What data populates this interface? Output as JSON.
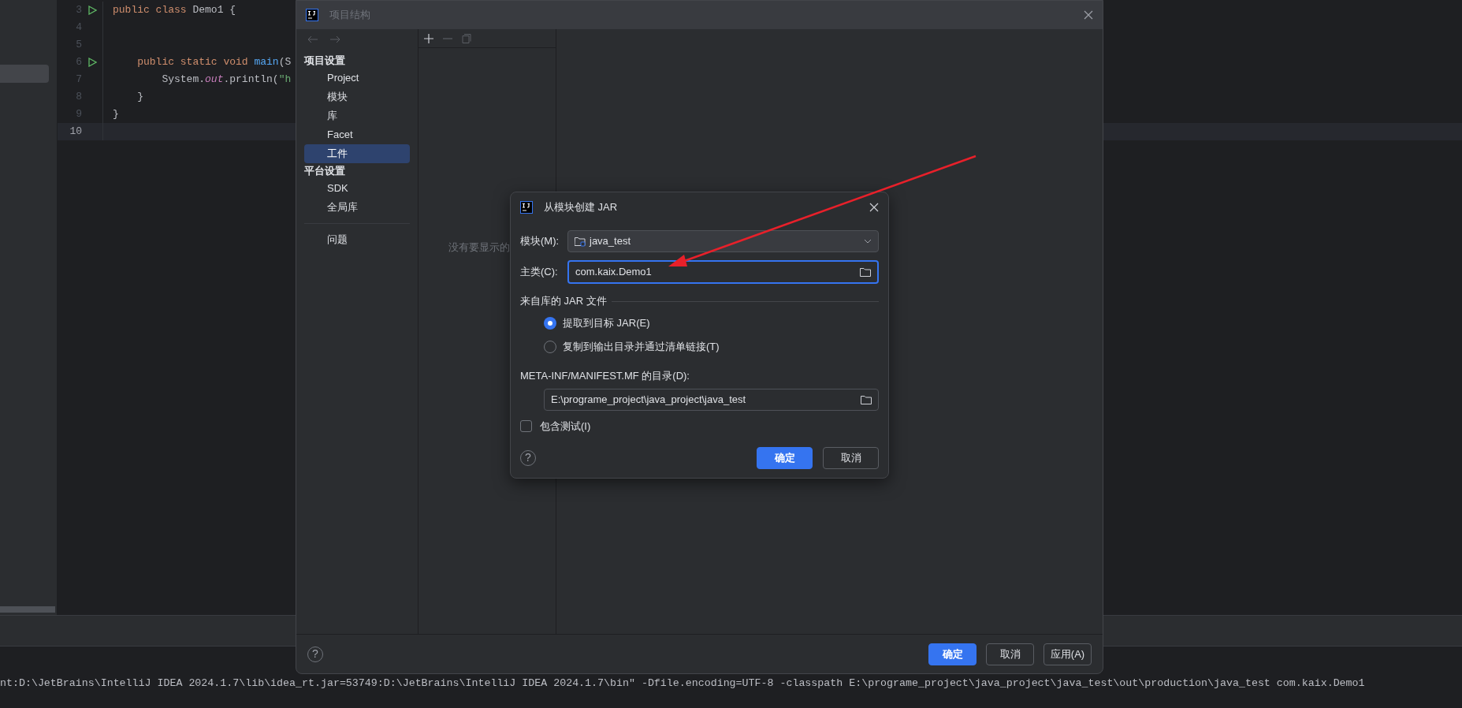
{
  "editor": {
    "lines": [
      {
        "number": "3",
        "run": true,
        "current": false,
        "tokens": [
          {
            "kind": "keyword",
            "text": "public class "
          },
          {
            "kind": "plain",
            "text": "Demo1 {"
          }
        ]
      },
      {
        "number": "4",
        "run": false,
        "current": false
      },
      {
        "number": "5",
        "run": false,
        "current": false
      },
      {
        "number": "6",
        "run": true,
        "current": false,
        "tokens": [
          {
            "kind": "keyword",
            "text": "    public static void "
          },
          {
            "kind": "method",
            "text": "main"
          },
          {
            "kind": "plain",
            "text": "(S"
          }
        ]
      },
      {
        "number": "7",
        "run": false,
        "current": false,
        "tokens": [
          {
            "kind": "plain",
            "text": "        System."
          },
          {
            "kind": "field",
            "text": "out"
          },
          {
            "kind": "plain",
            "text": ".println("
          },
          {
            "kind": "string",
            "text": "\"h"
          }
        ]
      },
      {
        "number": "8",
        "run": false,
        "current": false,
        "tokens": [
          {
            "kind": "plain",
            "text": "    }"
          }
        ]
      },
      {
        "number": "9",
        "run": false,
        "current": false,
        "tokens": [
          {
            "kind": "plain",
            "text": "}"
          }
        ]
      },
      {
        "number": "10",
        "run": false,
        "current": true
      }
    ]
  },
  "console": {
    "text": "nt:D:\\JetBrains\\IntelliJ IDEA 2024.1.7\\lib\\idea_rt.jar=53749:D:\\JetBrains\\IntelliJ IDEA 2024.1.7\\bin\" -Dfile.encoding=UTF-8 -classpath E:\\programe_project\\java_project\\java_test\\out\\production\\java_test com.kaix.Demo1"
  },
  "project_structure": {
    "title": "项目结构",
    "nav": [
      {
        "kind": "header",
        "label": "项目设置"
      },
      {
        "kind": "item",
        "label": "Project",
        "selected": false
      },
      {
        "kind": "item",
        "label": "模块",
        "selected": false
      },
      {
        "kind": "item",
        "label": "库",
        "selected": false
      },
      {
        "kind": "item",
        "label": "Facet",
        "selected": false
      },
      {
        "kind": "item",
        "label": "工件",
        "selected": true
      },
      {
        "kind": "header",
        "label": "平台设置"
      },
      {
        "kind": "item",
        "label": "SDK",
        "selected": false
      },
      {
        "kind": "item",
        "label": "全局库",
        "selected": false
      },
      {
        "kind": "divider"
      },
      {
        "kind": "item",
        "label": "问题",
        "selected": false
      }
    ],
    "empty_text": "没有要显示的",
    "help": "?",
    "buttons": [
      {
        "label": "确定",
        "primary": true
      },
      {
        "label": "取消",
        "primary": false
      },
      {
        "label": "应用(A)",
        "primary": false
      }
    ]
  },
  "create_jar": {
    "title": "从模块创建 JAR",
    "module": {
      "label": "模块(M):",
      "value": "java_test"
    },
    "main_class": {
      "label": "主类(C):",
      "value": "com.kaix.Demo1"
    },
    "section": "来自库的 JAR 文件",
    "options": [
      {
        "label": "提取到目标 JAR(E)",
        "selected": true
      },
      {
        "label": "复制到输出目录并通过清单链接(T)",
        "selected": false
      }
    ],
    "manifest": {
      "label": "META-INF/MANIFEST.MF 的目录(D):",
      "value": "E:\\programe_project\\java_project\\java_test"
    },
    "include_tests": {
      "label": "包含测试(I)",
      "checked": false
    },
    "help": "?",
    "buttons": [
      {
        "label": "确定",
        "primary": true
      },
      {
        "label": "取消",
        "primary": false
      }
    ]
  }
}
